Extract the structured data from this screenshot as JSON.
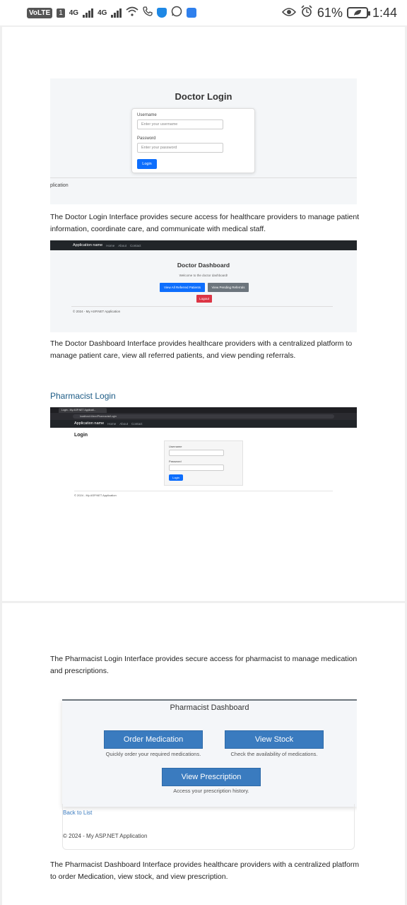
{
  "status_bar": {
    "volte": "VoLTE",
    "sim": "1",
    "net1": "4G",
    "net2": "4G",
    "battery_percent": "61%",
    "time": "1:44"
  },
  "doctor_login": {
    "title": "Doctor Login",
    "username_label": "Username",
    "username_placeholder": "Enter your username",
    "password_label": "Password",
    "password_placeholder": "Enter your password",
    "login_button": "Login",
    "footer_fragment": "plication",
    "caption": "The Doctor Login Interface provides secure access for healthcare providers to manage patient information, coordinate care, and communicate with medical staff."
  },
  "doctor_dashboard": {
    "nav_brand": "Application name",
    "nav_links": [
      "Home",
      "About",
      "Contact"
    ],
    "title": "Doctor Dashboard",
    "welcome": "Welcome to the doctor dashboard!",
    "btn_view_all": "View All Referred Patients",
    "btn_pending": "View Pending Referrals",
    "btn_logout": "Logout",
    "footer": "© 2024 - My ASP.NET Application",
    "caption": "The Doctor Dashboard Interface provides healthcare providers with a centralized platform to manage patient care, view all referred patients, and view pending referrals."
  },
  "pharmacist_login": {
    "heading": "Pharmacist Login",
    "tab_title": "Login - My ASP.NET Applicati...",
    "url": "localhost:44xxx/Pharmacist/Login",
    "nav_brand": "Application name",
    "nav_links": [
      "Home",
      "About",
      "Contact"
    ],
    "page_heading": "Login",
    "username_label": "Username",
    "password_label": "Password",
    "login_button": "Login",
    "footer": "© 2024 - My ASP.NET Application",
    "caption": "The Pharmacist Login Interface provides secure access for pharmacist to manage medication and prescriptions."
  },
  "pharmacist_dashboard": {
    "title": "Pharmacist Dashboard",
    "btn_order": "Order Medication",
    "order_sub": "Quickly order your required medications.",
    "btn_stock": "View Stock",
    "stock_sub": "Check the availability of medications.",
    "btn_prescription": "View Prescription",
    "prescription_sub": "Access your prescription history.",
    "back_link": "Back to List",
    "footer": "© 2024 - My ASP.NET Application",
    "caption": "The Pharmacist Dashboard Interface provides healthcare providers with a centralized platform to order Medication, view stock, and view prescription."
  },
  "colors": {
    "primary_blue": "#0d6efd",
    "secondary_gray": "#6c757d",
    "danger_red": "#dc3545",
    "pharmacy_blue": "#3a7bbf",
    "heading_blue": "#1c5b85",
    "navbar_dark": "#212529"
  }
}
